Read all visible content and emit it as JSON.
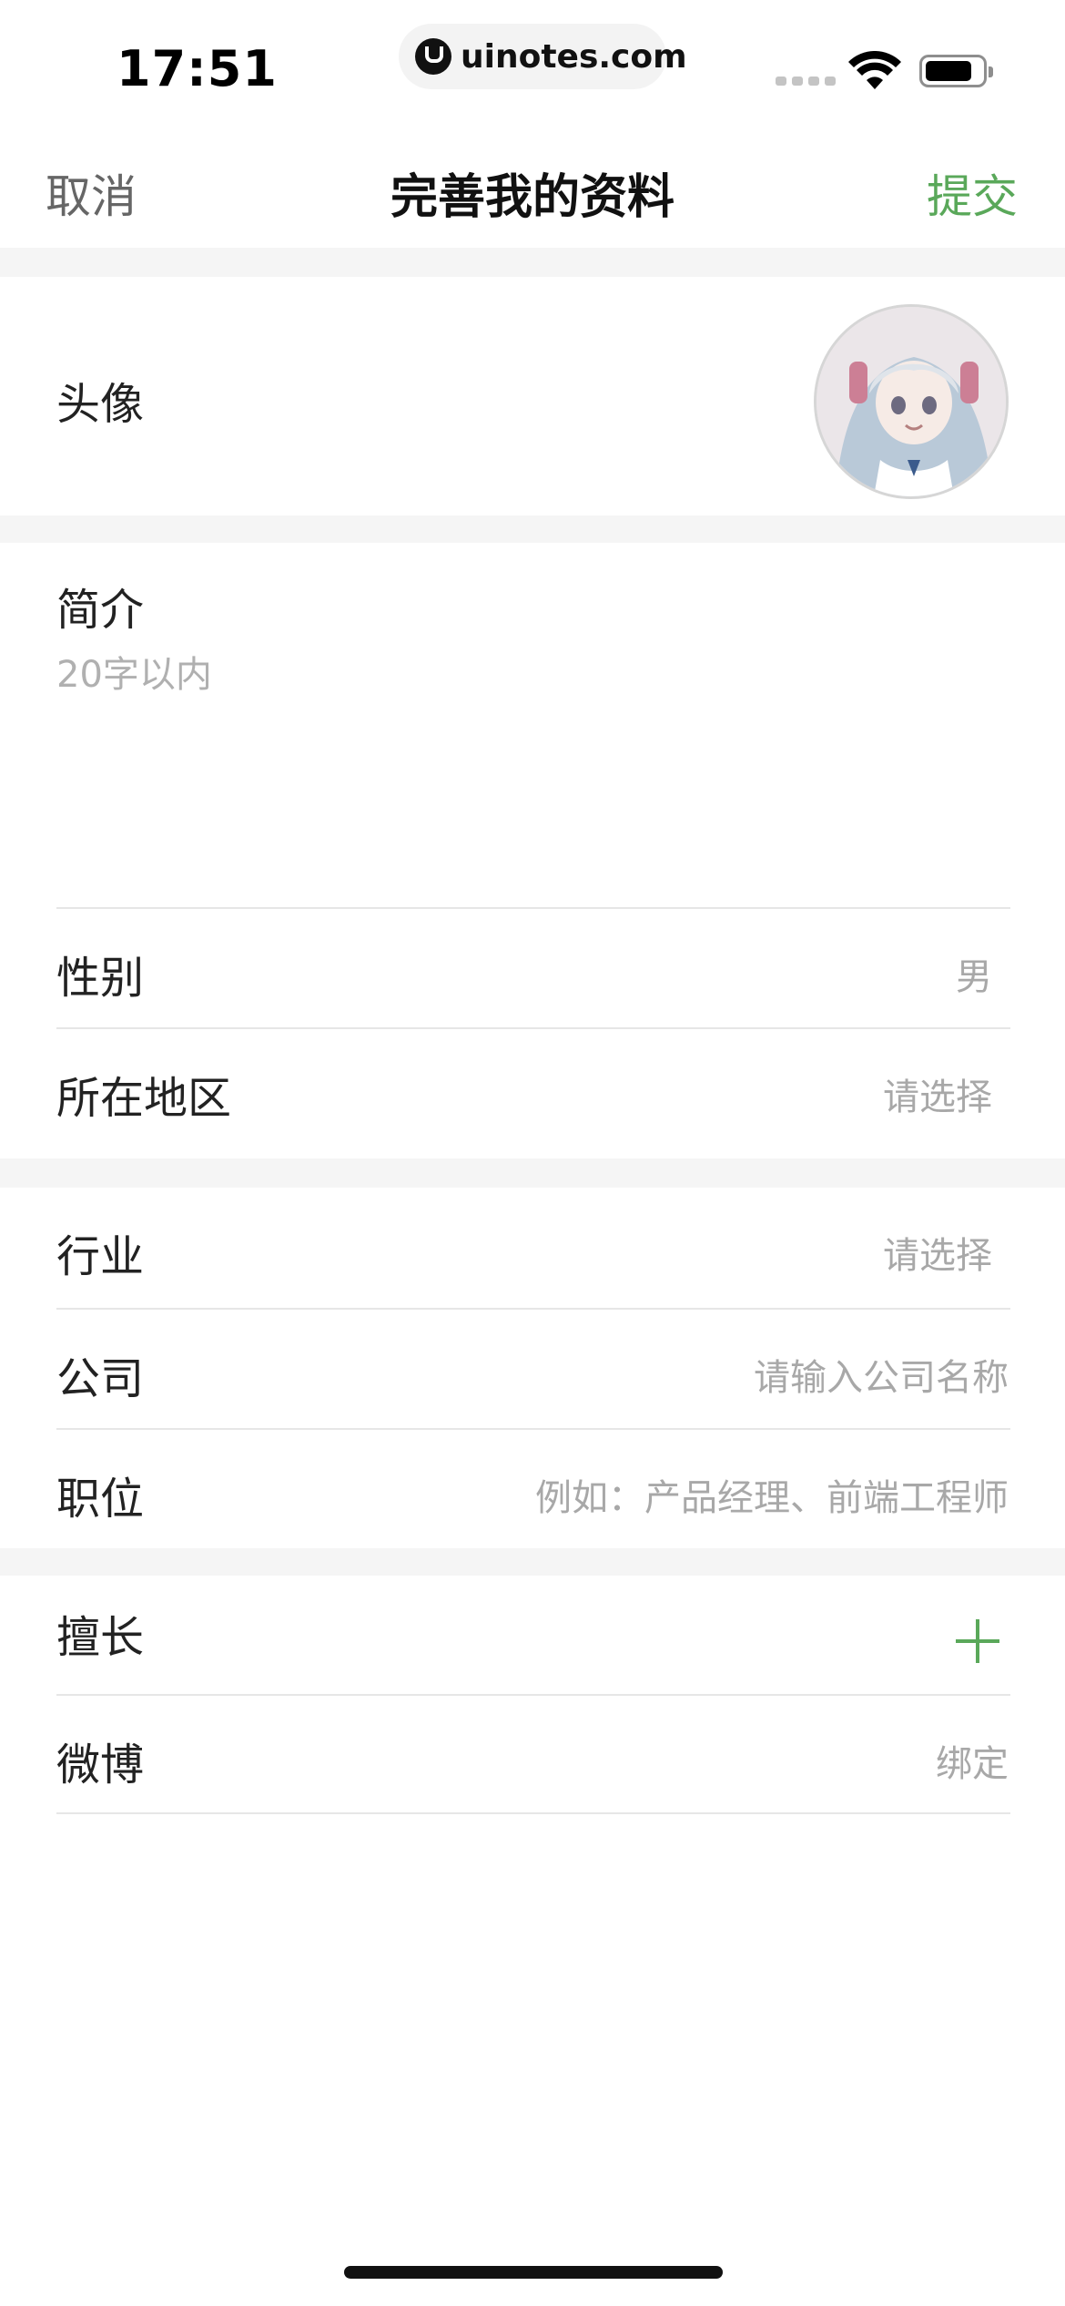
{
  "status_bar": {
    "time": "17:51",
    "url": "uinotes.com"
  },
  "nav": {
    "cancel_label": "取消",
    "title": "完善我的资料",
    "submit_label": "提交"
  },
  "avatar_row": {
    "label": "头像"
  },
  "bio": {
    "label": "简介",
    "placeholder": "20字以内"
  },
  "basic": [
    {
      "label": "性别",
      "value": "男"
    },
    {
      "label": "所在地区",
      "value": "请选择"
    }
  ],
  "work": [
    {
      "label": "行业",
      "value": "请选择"
    },
    {
      "label": "公司",
      "placeholder": "请输入公司名称"
    },
    {
      "label": "职位",
      "placeholder": "例如：产品经理、前端工程师"
    }
  ],
  "extra": [
    {
      "label": "擅长",
      "icon": "plus-icon"
    },
    {
      "label": "微博",
      "value": "绑定"
    }
  ],
  "colors": {
    "accent_green": "#5aa85a",
    "placeholder_gray": "#a8a8a8",
    "section_gap": "#f5f5f5"
  }
}
